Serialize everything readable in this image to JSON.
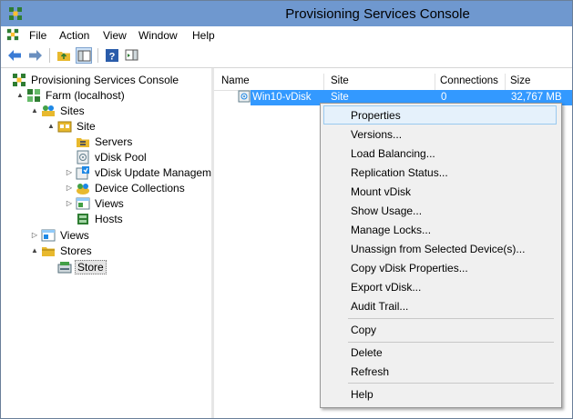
{
  "window": {
    "title": "Provisioning Services Console"
  },
  "menubar": {
    "items": [
      "File",
      "Action",
      "View",
      "Window",
      "Help"
    ]
  },
  "toolbar": {
    "buttons": [
      "back-icon",
      "forward-icon",
      "up-folder-icon",
      "show-hide-tree-icon",
      "help-icon",
      "action-pane-icon"
    ]
  },
  "tree": {
    "nodes": [
      {
        "label": "Provisioning Services Console",
        "icon": "console-icon",
        "expander": ""
      },
      {
        "label": "Farm (localhost)",
        "icon": "farm-icon",
        "expander": "▲"
      },
      {
        "label": "Sites",
        "icon": "sites-icon",
        "expander": "▲"
      },
      {
        "label": "Site",
        "icon": "site-icon",
        "expander": "▲"
      },
      {
        "label": "Servers",
        "icon": "servers-icon",
        "expander": ""
      },
      {
        "label": "vDisk Pool",
        "icon": "vdisk-pool-icon",
        "expander": ""
      },
      {
        "label": "vDisk Update Manageme",
        "icon": "vdisk-update-icon",
        "expander": "▷"
      },
      {
        "label": "Device Collections",
        "icon": "device-collections-icon",
        "expander": "▷"
      },
      {
        "label": "Views",
        "icon": "views-icon",
        "expander": "▷"
      },
      {
        "label": "Hosts",
        "icon": "hosts-icon",
        "expander": ""
      },
      {
        "label": "Views",
        "icon": "views-icon",
        "expander": "▷"
      },
      {
        "label": "Stores",
        "icon": "stores-icon",
        "expander": "▲"
      },
      {
        "label": "Store",
        "icon": "store-icon",
        "expander": ""
      }
    ]
  },
  "list": {
    "columns": [
      "Name",
      "Site",
      "Connections",
      "Size"
    ],
    "rows": [
      {
        "name": "Win10-vDisk",
        "site": "Site",
        "connections": "0",
        "size": "32,767 MB"
      }
    ]
  },
  "context_menu": {
    "items": [
      "Properties",
      "Versions...",
      "Load Balancing...",
      "Replication Status...",
      "Mount vDisk",
      "Show Usage...",
      "Manage Locks...",
      "Unassign from Selected Device(s)...",
      "Copy vDisk Properties...",
      "Export vDisk...",
      "Audit Trail...",
      "Copy",
      "Delete",
      "Refresh",
      "Help"
    ],
    "highlighted": "Properties"
  },
  "colors": {
    "titlebar": "#6f98cf",
    "selection": "#3399ff",
    "menu_highlight": "#e5f1fb"
  }
}
